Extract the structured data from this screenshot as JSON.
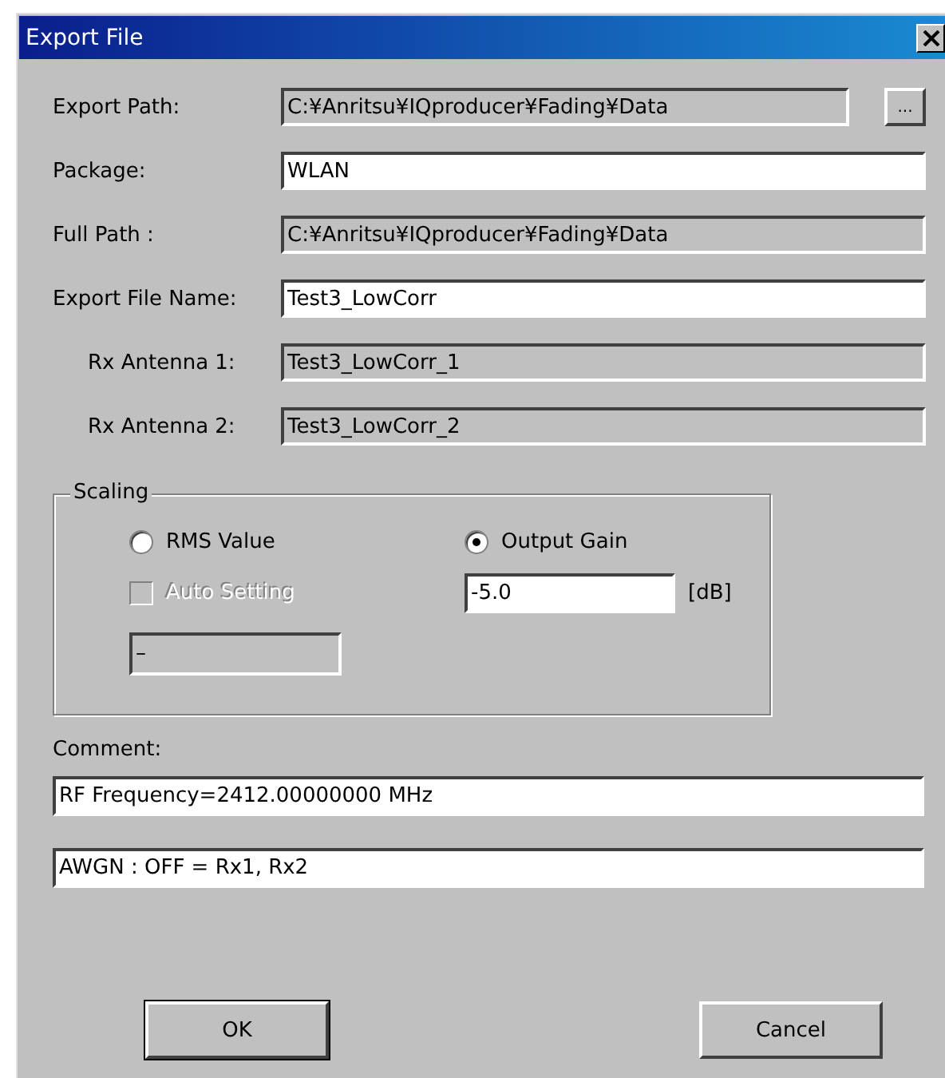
{
  "window": {
    "title": "Export File"
  },
  "rows": [
    {
      "label": "Export Path:",
      "value": "C:¥Anritsu¥IQproducer¥Fading¥Data",
      "disabled": true,
      "browse_button": "..."
    },
    {
      "label": "Package:",
      "value": "WLAN",
      "disabled": false
    },
    {
      "label": "Full Path :",
      "value": "C:¥Anritsu¥IQproducer¥Fading¥Data",
      "disabled": true
    },
    {
      "label": "Export File Name:",
      "value": "Test3_LowCorr",
      "disabled": false,
      "children": [
        {
          "label": "Rx Antenna 1:",
          "value": "Test3_LowCorr_1",
          "disabled": true
        },
        {
          "label": "Rx Antenna 2:",
          "value": "Test3_LowCorr_2",
          "disabled": true
        }
      ]
    }
  ],
  "scaling": {
    "title": "Scaling",
    "radios": [
      {
        "label": "RMS Value",
        "selected": false
      },
      {
        "label": "Output Gain",
        "selected": true
      }
    ],
    "auto_setting": {
      "label": "Auto Setting",
      "checked": false,
      "disabled": true
    },
    "rms_field": {
      "value": "–",
      "disabled": true
    },
    "gain_field": {
      "value": "-5.0",
      "disabled": false
    },
    "unit": "[dB]"
  },
  "comment": {
    "label": "Comment:",
    "lines": [
      "RF Frequency=2412.00000000 MHz",
      "AWGN : OFF = Rx1, Rx2"
    ]
  },
  "buttons": [
    "OK",
    "Cancel"
  ]
}
